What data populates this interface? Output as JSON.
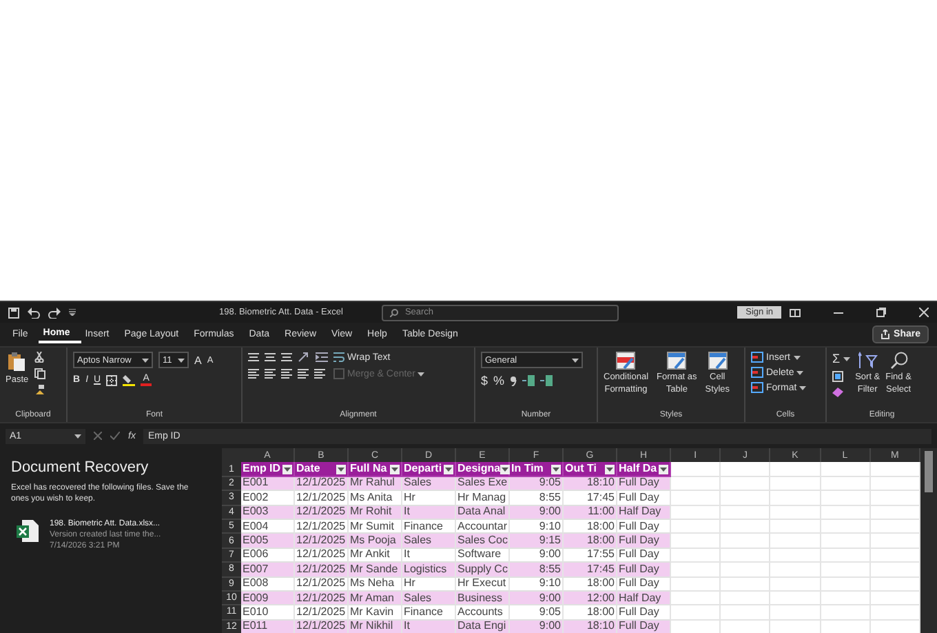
{
  "title_bar": {
    "title": "198. Biometric Att. Data  -  Excel",
    "search": {
      "placeholder": "Search"
    },
    "sign_in": "Sign in"
  },
  "tabs": [
    {
      "label": "File",
      "selected": false
    },
    {
      "label": "Home",
      "selected": true
    },
    {
      "label": "Insert",
      "selected": false
    },
    {
      "label": "Page Layout",
      "selected": false
    },
    {
      "label": "Formulas",
      "selected": false
    },
    {
      "label": "Data",
      "selected": false
    },
    {
      "label": "Review",
      "selected": false
    },
    {
      "label": "View",
      "selected": false
    },
    {
      "label": "Help",
      "selected": false
    },
    {
      "label": "Table Design",
      "selected": false
    }
  ],
  "share": "Share",
  "ribbon": {
    "clipboard": {
      "paste": "Paste",
      "label": "Clipboard"
    },
    "font": {
      "font_name": "Aptos Narrow",
      "font_size": "11",
      "size_buttons": [
        "A",
        "A"
      ],
      "style_buttons": [
        "B",
        "I",
        "U"
      ],
      "font_color": "A",
      "label": "Font"
    },
    "alignment": {
      "wrap_text": "Wrap Text",
      "merge": {
        "label": "Merge & Center",
        "disabled": true
      },
      "label": "Alignment"
    },
    "number": {
      "format": "General",
      "symbols": [
        "$",
        "%"
      ],
      "label": "Number"
    },
    "styles": {
      "buttons": [
        {
          "line1": "Conditional",
          "line2": "Formatting"
        },
        {
          "line1": "Format as",
          "line2": "Table"
        },
        {
          "line1": "Cell",
          "line2": "Styles"
        }
      ],
      "label": "Styles"
    },
    "cells": {
      "buttons": [
        "Insert",
        "Delete",
        "Format"
      ],
      "label": "Cells"
    },
    "editing": {
      "sigma": "Σ",
      "buttons": [
        {
          "line1": "Sort &",
          "line2": "Filter"
        },
        {
          "line1": "Find &",
          "line2": "Select"
        }
      ],
      "label": "Editing"
    }
  },
  "formula_bar": {
    "name_box": "A1",
    "function_label": "fx",
    "value": "Emp ID"
  },
  "recovery": {
    "title": "Document Recovery",
    "message": "Excel has recovered the following files.  Save the ones you wish to keep.",
    "file": {
      "name": "198. Biometric Att. Data.xlsx...",
      "note": "Version created last time the...",
      "time": "7/14/2026 3:21 PM"
    }
  },
  "sheet": {
    "column_letters": [
      "A",
      "B",
      "C",
      "D",
      "E",
      "F",
      "G",
      "H",
      "I",
      "J",
      "K",
      "L",
      "M"
    ],
    "header": {
      "number": "1",
      "cells": [
        "Emp ID",
        "Date",
        "Full Na",
        "Departi",
        "Designa",
        "In Tim",
        "Out Ti",
        "Half Da"
      ]
    },
    "rows": [
      {
        "number": "2",
        "cells": [
          "E001",
          "12/1/2025",
          "Mr  Rahul",
          "Sales",
          "Sales Exe",
          "9:05",
          "18:10",
          "Full Day"
        ]
      },
      {
        "number": "3",
        "cells": [
          "E002",
          "12/1/2025",
          "Ms  Anita",
          "Hr",
          "Hr Manag",
          "8:55",
          "17:45",
          "Full Day"
        ]
      },
      {
        "number": "4",
        "cells": [
          "E003",
          "12/1/2025",
          "Mr  Rohit",
          "It",
          "Data Anal",
          "9:00",
          "11:00",
          "Half Day"
        ]
      },
      {
        "number": "5",
        "cells": [
          "E004",
          "12/1/2025",
          "Mr  Sumit",
          "Finance",
          "Accountar",
          "9:10",
          "18:00",
          "Full Day"
        ]
      },
      {
        "number": "6",
        "cells": [
          "E005",
          "12/1/2025",
          "Ms  Pooja",
          "Sales",
          "Sales Coc",
          "9:15",
          "18:00",
          "Full Day"
        ]
      },
      {
        "number": "7",
        "cells": [
          "E006",
          "12/1/2025",
          "Mr  Ankit",
          "It",
          "Software",
          "9:00",
          "17:55",
          "Full Day"
        ]
      },
      {
        "number": "8",
        "cells": [
          "E007",
          "12/1/2025",
          "Mr  Sande",
          "Logistics",
          "Supply Cc",
          "8:55",
          "17:45",
          "Full Day"
        ]
      },
      {
        "number": "9",
        "cells": [
          "E008",
          "12/1/2025",
          "Ms  Neha",
          "Hr",
          "Hr Execut",
          "9:10",
          "18:00",
          "Full Day"
        ]
      },
      {
        "number": "10",
        "cells": [
          "E009",
          "12/1/2025",
          "Mr  Aman",
          "Sales",
          "Business",
          "9:00",
          "12:00",
          "Half Day"
        ]
      },
      {
        "number": "11",
        "cells": [
          "E010",
          "12/1/2025",
          "Mr  Kavin",
          "Finance",
          "Accounts",
          "9:05",
          "18:00",
          "Full Day"
        ]
      },
      {
        "number": "12",
        "cells": [
          "E011",
          "12/1/2025",
          "Mr  Nikhil",
          "It",
          "Data Engi",
          "9:00",
          "18:10",
          "Full Day"
        ]
      }
    ]
  }
}
